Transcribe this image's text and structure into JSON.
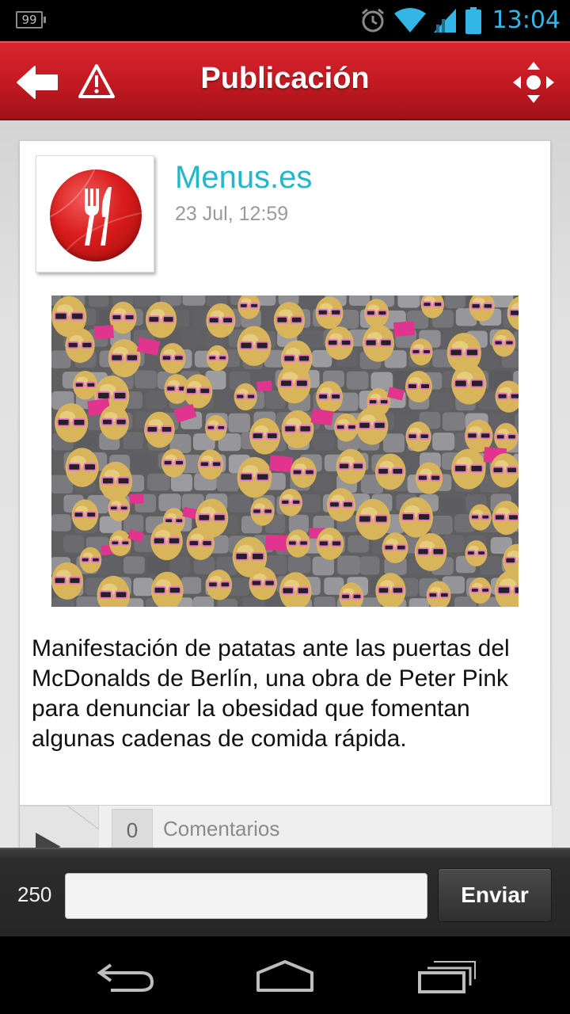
{
  "status_bar": {
    "battery_level": "99",
    "time": "13:04",
    "icons": [
      "battery-icon",
      "alarm-icon",
      "wifi-icon",
      "signal-icon",
      "battery-full-icon"
    ]
  },
  "action_bar": {
    "title": "Publicación",
    "icons": [
      "back-arrow-icon",
      "warning-icon",
      "navigation-icon"
    ]
  },
  "post": {
    "author": "Menus.es",
    "date": "23 Jul, 12:59",
    "avatar_icon": "fork-knife-icon",
    "image_icon": "photo-potatoes-sunglasses",
    "text": "Manifestación de patatas ante las puertas del McDonalds de Berlín, una obra de Peter Pink para denunciar la obesidad que fomentan algunas cadenas de comida rápida.",
    "comments": {
      "count": "0",
      "label": "Comentarios"
    }
  },
  "composer": {
    "char_count": "250",
    "input_value": "",
    "send_label": "Enviar"
  },
  "nav_bar": {
    "icons": [
      "back-icon",
      "home-icon",
      "recent-apps-icon"
    ]
  },
  "colors": {
    "accent": "#33b5e5",
    "brand_red": "#c41a22",
    "author_link": "#21b8c9"
  }
}
